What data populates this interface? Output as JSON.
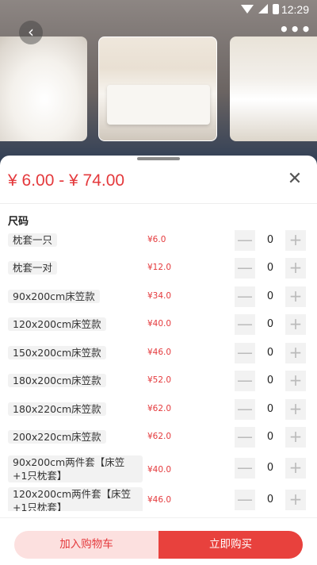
{
  "status_bar": {
    "time": "12:29"
  },
  "header": {
    "back_icon": "chevron-left-icon",
    "more_icon": "more-dots-icon"
  },
  "sheet": {
    "price_range": "¥ 6.00 - ¥ 74.00",
    "close_icon": "close-icon",
    "section_title": "尺码",
    "options": [
      {
        "label": "枕套一只",
        "price": "¥6.0",
        "qty": "0"
      },
      {
        "label": "枕套一对",
        "price": "¥12.0",
        "qty": "0"
      },
      {
        "label": "90x200cm床笠款",
        "price": "¥34.0",
        "qty": "0"
      },
      {
        "label": "120x200cm床笠款",
        "price": "¥40.0",
        "qty": "0"
      },
      {
        "label": "150x200cm床笠款",
        "price": "¥46.0",
        "qty": "0"
      },
      {
        "label": "180x200cm床笠款",
        "price": "¥52.0",
        "qty": "0"
      },
      {
        "label": "180x220cm床笠款",
        "price": "¥62.0",
        "qty": "0"
      },
      {
        "label": "200x220cm床笠款",
        "price": "¥62.0",
        "qty": "0"
      },
      {
        "label": "90x200cm两件套【床笠+1只枕套】",
        "price": "¥40.0",
        "qty": "0"
      },
      {
        "label": "120x200cm两件套【床笠+1只枕套】",
        "price": "¥46.0",
        "qty": "0"
      }
    ],
    "minus_symbol": "—",
    "plus_symbol": "+"
  },
  "actions": {
    "add_to_cart": "加入购物车",
    "buy_now": "立即购买"
  },
  "colors": {
    "accent": "#e4393c",
    "cart_bg": "#fce0df",
    "buy_bg": "#e8413d"
  }
}
